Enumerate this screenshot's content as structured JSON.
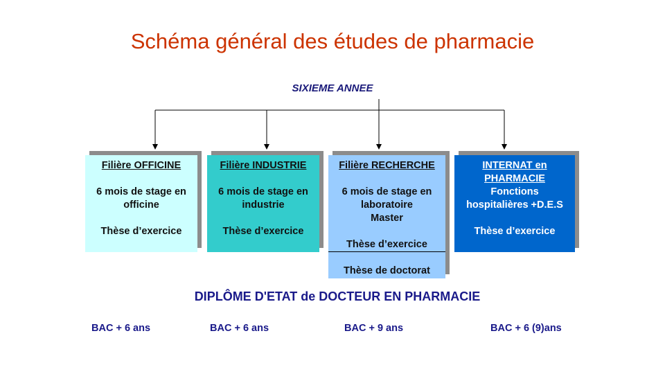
{
  "title": "Schéma général des études de pharmacie",
  "top_label": "SIXIEME ANNEE",
  "boxes": [
    {
      "head": "Filière OFFICINE",
      "lines": [
        "6 mois de stage en",
        "officine"
      ],
      "these": "Thèse d’exercice"
    },
    {
      "head": "Filière INDUSTRIE",
      "lines": [
        "6 mois de stage en",
        "industrie"
      ],
      "these": "Thèse d’exercice"
    },
    {
      "head": "Filière RECHERCHE",
      "lines": [
        "6 mois de stage en",
        "laboratoire",
        "Master"
      ],
      "these": "Thèse d’exercice",
      "extra": "Thèse de doctorat"
    },
    {
      "head_lines": [
        "INTERNAT en",
        "PHARMACIE"
      ],
      "lines": [
        "Fonctions",
        "hospitalières +D.E.S"
      ],
      "these": "Thèse d’exercice"
    }
  ],
  "diploma": "DIPLÔME D'ETAT de DOCTEUR EN PHARMACIE",
  "durations": [
    "BAC + 6 ans",
    "BAC + 6 ans",
    "BAC + 9 ans",
    "BAC + 6 (9)ans"
  ],
  "colors": {
    "title": "#cc3300",
    "text_blue": "#1a1a8a",
    "officine": "#ccffff",
    "industrie": "#33cccc",
    "recherche": "#99ccff",
    "internat": "#0066cc",
    "shadow": "#8c8c8c"
  }
}
